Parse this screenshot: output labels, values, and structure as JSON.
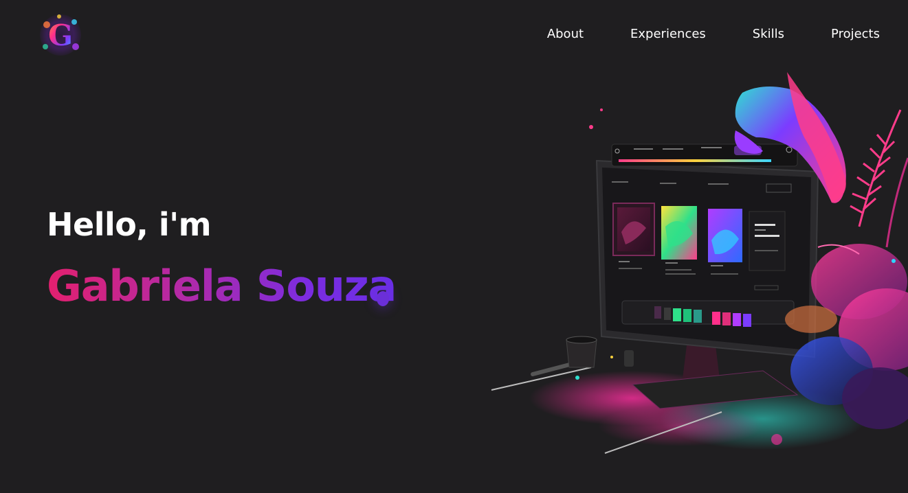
{
  "header": {
    "nav": [
      {
        "label": "About"
      },
      {
        "label": "Experiences"
      },
      {
        "label": "Skills"
      },
      {
        "label": "Projects"
      }
    ]
  },
  "hero": {
    "greeting": "Hello, i'm",
    "name": "Gabriela Souza"
  },
  "colors": {
    "background": "#1f1e20",
    "name_gradient_start": "#e3206e",
    "name_gradient_end": "#6a2fe6",
    "accent_purple": "#6b2fd8"
  }
}
